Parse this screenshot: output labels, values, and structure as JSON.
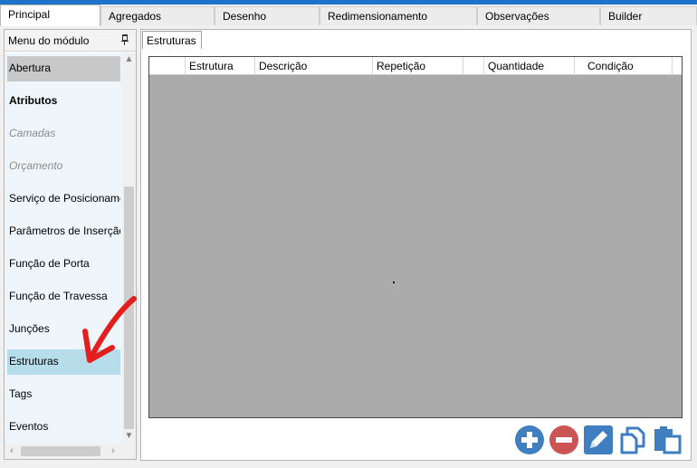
{
  "tabs": [
    {
      "label": "Principal"
    },
    {
      "label": "Agregados"
    },
    {
      "label": "Desenho"
    },
    {
      "label": "Redimensionamento"
    },
    {
      "label": "Observações"
    },
    {
      "label": "Builder"
    }
  ],
  "module_menu": {
    "title": "Menu do módulo",
    "items": [
      {
        "label": "Abertura"
      },
      {
        "label": "Atributos"
      },
      {
        "label": "Camadas"
      },
      {
        "label": "Orçamento"
      },
      {
        "label": "Serviço de Posicionamento"
      },
      {
        "label": "Parâmetros de Inserção"
      },
      {
        "label": "Função de Porta"
      },
      {
        "label": "Função de Travessa"
      },
      {
        "label": "Junções"
      },
      {
        "label": "Estruturas"
      },
      {
        "label": "Tags"
      },
      {
        "label": "Eventos"
      }
    ]
  },
  "content": {
    "tab_label": "Estruturas",
    "columns": [
      "Estrutura",
      "Descrição",
      "Repetição",
      "",
      "Quantidade",
      "Condição"
    ]
  },
  "colors": {
    "accent": "#1f74c9",
    "selected_row": "#b7dcea",
    "grid_background": "#ababab",
    "add_button": "#3f7fc1",
    "remove_button": "#cc5454"
  },
  "icons": [
    "pin-icon",
    "plus-icon",
    "minus-icon",
    "pencil-icon",
    "copy-icon",
    "paste-icon"
  ]
}
